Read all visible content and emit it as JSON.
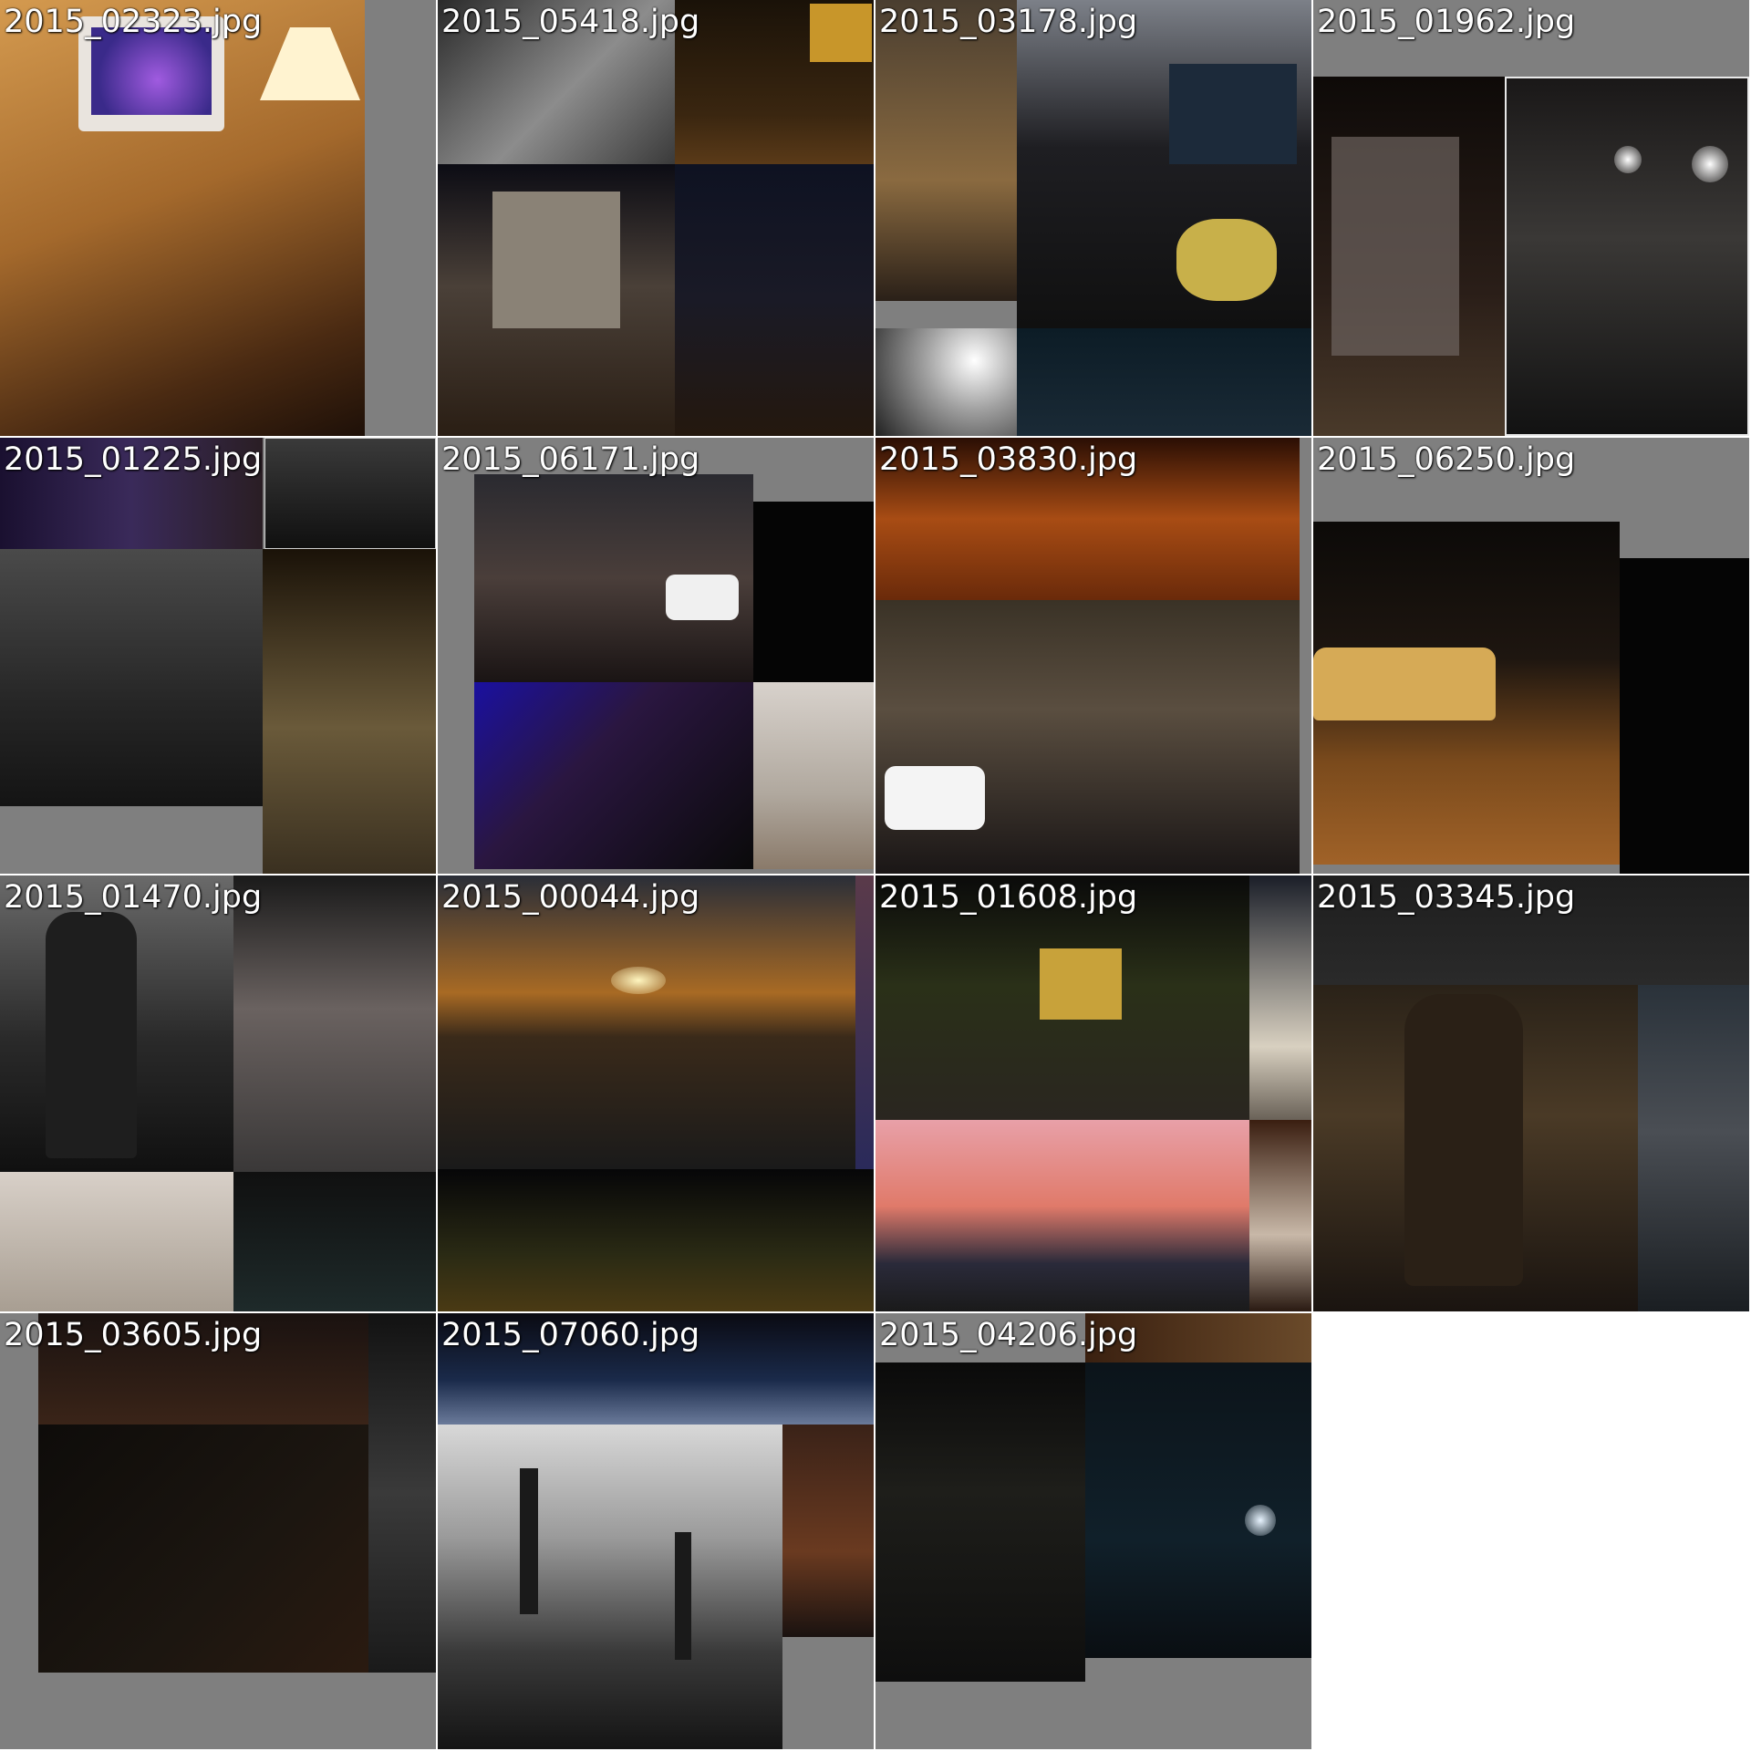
{
  "tiles": [
    {
      "filename": "2015_02323.jpg"
    },
    {
      "filename": "2015_05418.jpg"
    },
    {
      "filename": "2015_03178.jpg"
    },
    {
      "filename": "2015_01962.jpg"
    },
    {
      "filename": "2015_01225.jpg"
    },
    {
      "filename": "2015_06171.jpg"
    },
    {
      "filename": "2015_03830.jpg"
    },
    {
      "filename": "2015_06250.jpg"
    },
    {
      "filename": "2015_01470.jpg"
    },
    {
      "filename": "2015_00044.jpg"
    },
    {
      "filename": "2015_01608.jpg"
    },
    {
      "filename": "2015_03345.jpg"
    },
    {
      "filename": "2015_03605.jpg"
    },
    {
      "filename": "2015_07060.jpg"
    },
    {
      "filename": "2015_04206.jpg"
    }
  ]
}
